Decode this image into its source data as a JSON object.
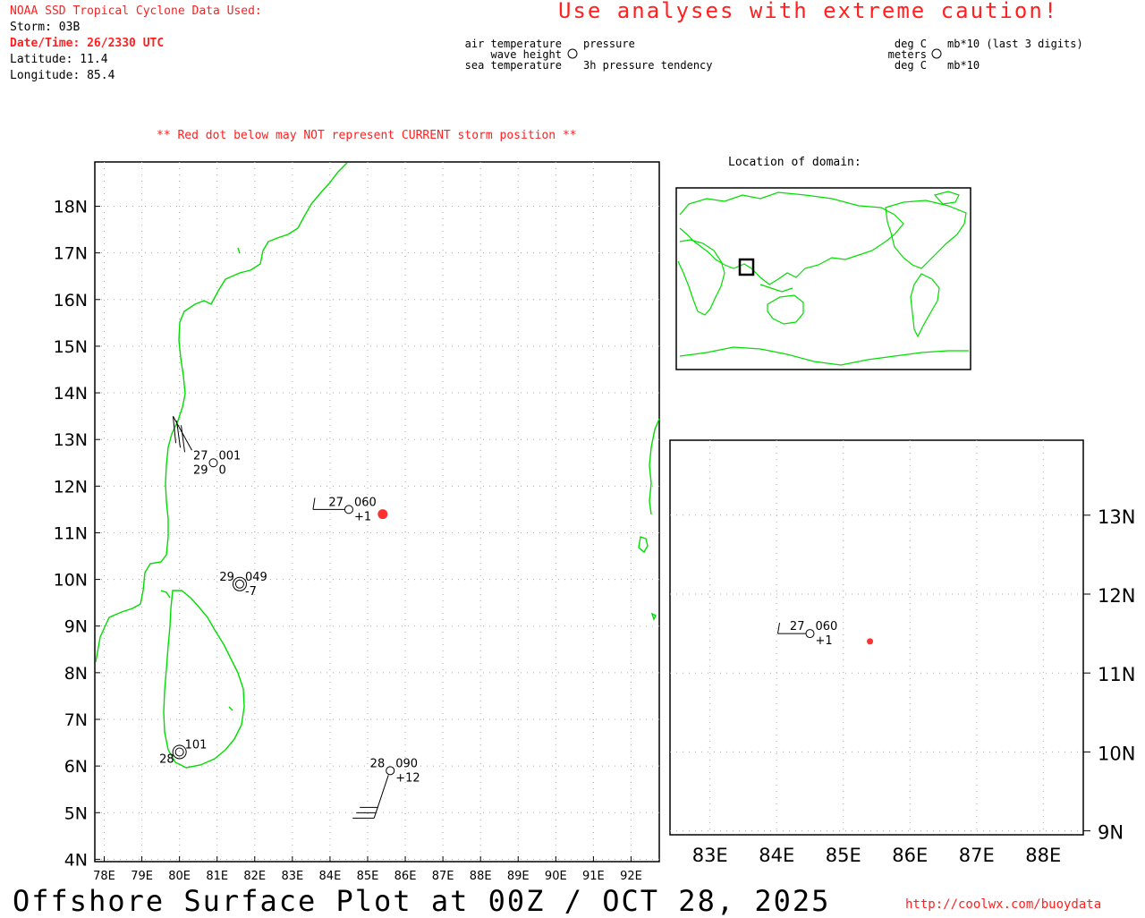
{
  "header": {
    "source": "NOAA SSD Tropical Cyclone Data Used:",
    "storm": "Storm: 03B",
    "datetime": "Date/Time: 26/2330 UTC",
    "latitude": "Latitude: 11.4",
    "longitude": "Longitude: 85.4",
    "caution": "Use analyses with extreme caution!"
  },
  "legend_left": {
    "air_temp": "air temperature",
    "wave_height": "wave height",
    "sea_temp": "sea temperature",
    "pressure": "pressure",
    "tendency": "3h pressure tendency"
  },
  "legend_right": {
    "deg_c_top": "deg C",
    "meters": "meters",
    "deg_c_bottom": "deg C",
    "mb_last3": "mb*10 (last 3 digits)",
    "mb": "mb*10"
  },
  "warning": "** Red dot below may NOT represent CURRENT storm position **",
  "inset_title": "Location of domain:",
  "footer": {
    "title": "Offshore Surface Plot at 00Z / OCT 28, 2025",
    "url": "http://coolwx.com/buoydata"
  },
  "colors": {
    "coast": "#00dd00",
    "storm": "#ff3030",
    "text_red": "#ff2020",
    "grid": "#aaaaaa"
  },
  "main_map": {
    "lon_range": [
      77.75,
      92.75
    ],
    "lat_range": [
      3.95,
      18.95
    ],
    "lon_labels": [
      "78E",
      "79E",
      "80E",
      "81E",
      "82E",
      "83E",
      "84E",
      "85E",
      "86E",
      "87E",
      "88E",
      "89E",
      "90E",
      "91E",
      "92E"
    ],
    "lat_labels": [
      "4N",
      "5N",
      "6N",
      "7N",
      "8N",
      "9N",
      "10N",
      "11N",
      "12N",
      "13N",
      "14N",
      "15N",
      "16N",
      "17N",
      "18N"
    ],
    "storm": {
      "lat": 11.4,
      "lon": 85.4
    },
    "stations": [
      {
        "id": "stn-a",
        "lat": 12.5,
        "lon": 80.9,
        "air": "27",
        "pressure": "001",
        "sst": "29",
        "tendency": "0",
        "wave": false
      },
      {
        "id": "stn-b",
        "lat": 11.5,
        "lon": 84.5,
        "air": "27",
        "pressure": "060",
        "sst": "",
        "tendency": "+1",
        "wave": false
      },
      {
        "id": "stn-c",
        "lat": 9.9,
        "lon": 81.6,
        "air": "29",
        "pressure": "049",
        "sst": "",
        "tendency": "-7",
        "wave": true
      },
      {
        "id": "stn-d",
        "lat": 6.3,
        "lon": 80.0,
        "air": "",
        "pressure": "101",
        "sst": "28",
        "tendency": "",
        "wave": true
      },
      {
        "id": "stn-e",
        "lat": 5.9,
        "lon": 85.6,
        "air": "28",
        "pressure": "090",
        "sst": "",
        "tendency": "+12",
        "wave": false
      }
    ]
  },
  "zoom_map": {
    "lon_range": [
      82.4,
      88.6
    ],
    "lat_range": [
      8.95,
      13.95
    ],
    "lon_labels": [
      "83E",
      "84E",
      "85E",
      "86E",
      "87E",
      "88E"
    ],
    "lat_labels": [
      "9N",
      "10N",
      "11N",
      "12N",
      "13N"
    ],
    "storm": {
      "lat": 11.4,
      "lon": 85.4
    },
    "station": {
      "air": "27",
      "pressure": "060",
      "tendency": "+1"
    }
  }
}
